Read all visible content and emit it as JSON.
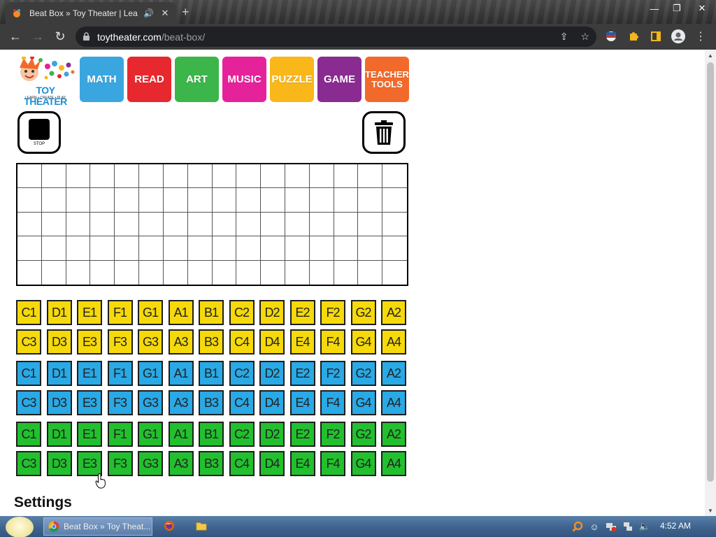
{
  "browser": {
    "tab_title": "Beat Box » Toy Theater | Lea",
    "tab_audio_icon": "speaker-icon",
    "url_host": "toytheater.com",
    "url_path": "/beat-box/"
  },
  "site": {
    "logo_brand": "TOY THEATER",
    "logo_tagline": "LEARN • CREATE • PLAY",
    "nav": [
      {
        "label": "MATH",
        "color": "#3aa6e0"
      },
      {
        "label": "READ",
        "color": "#e8282f"
      },
      {
        "label": "ART",
        "color": "#3cb54a"
      },
      {
        "label": "MUSIC",
        "color": "#e6229a"
      },
      {
        "label": "PUZZLE",
        "color": "#f9b71a"
      },
      {
        "label": "GAME",
        "color": "#8a2b91"
      },
      {
        "label": "TEACHER TOOLS",
        "color": "#f26a2b"
      }
    ]
  },
  "controls": {
    "stop_label": "STOP",
    "trash_icon": "trash-icon"
  },
  "note_colors": {
    "yellow": "#f5d90a",
    "blue": "#29a9e6",
    "green": "#22c02e"
  },
  "note_rows": [
    [
      "C1",
      "D1",
      "E1",
      "F1",
      "G1",
      "A1",
      "B1",
      "C2",
      "D2",
      "E2",
      "F2",
      "G2",
      "A2"
    ],
    [
      "C3",
      "D3",
      "E3",
      "F3",
      "G3",
      "A3",
      "B3",
      "C4",
      "D4",
      "E4",
      "F4",
      "G4",
      "A4"
    ],
    [
      "C1",
      "D1",
      "E1",
      "F1",
      "G1",
      "A1",
      "B1",
      "C2",
      "D2",
      "E2",
      "F2",
      "G2",
      "A2"
    ],
    [
      "C3",
      "D3",
      "E3",
      "F3",
      "G3",
      "A3",
      "B3",
      "C4",
      "D4",
      "E4",
      "F4",
      "G4",
      "A4"
    ],
    [
      "C1",
      "D1",
      "E1",
      "F1",
      "G1",
      "A1",
      "B1",
      "C2",
      "D2",
      "E2",
      "F2",
      "G2",
      "A2"
    ],
    [
      "C3",
      "D3",
      "E3",
      "F3",
      "G3",
      "A3",
      "B3",
      "C4",
      "D4",
      "E4",
      "F4",
      "G4",
      "A4"
    ]
  ],
  "settings_heading": "Settings",
  "taskbar": {
    "task_label": "Beat Box » Toy Theat...",
    "clock": "4:52 AM"
  }
}
